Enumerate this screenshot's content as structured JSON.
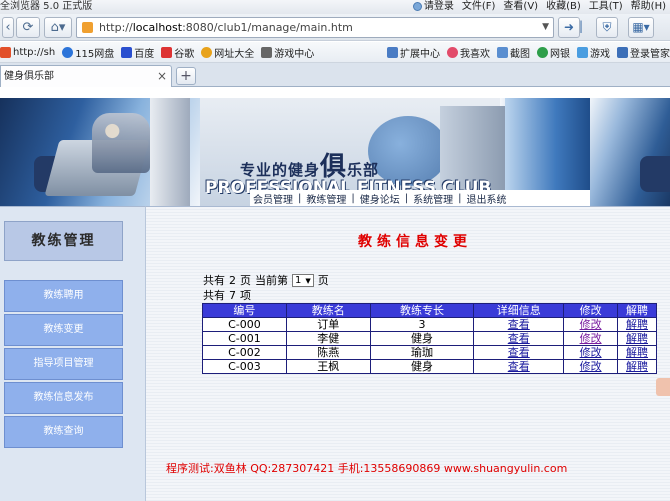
{
  "browser": {
    "app_title": "全浏览器 5.0 正式版",
    "login": "请登录",
    "menus": [
      "文件(F)",
      "查看(V)",
      "收藏(B)",
      "工具(T)",
      "帮助(H)"
    ],
    "url_prefix": "http://",
    "url_host": "localhost",
    "url_rest": ":8080/club1/manage/main.htm",
    "favorites": [
      "http://sh",
      "115网盘",
      "百度",
      "谷歌",
      "网址大全",
      "游戏中心"
    ],
    "fav_right": [
      "扩展中心",
      "我喜欢",
      "截图",
      "网银",
      "游戏",
      "登录管家"
    ],
    "tab_title": "健身俱乐部",
    "tab_close": "×",
    "new_tab": "+"
  },
  "banner": {
    "slogan_pre": "专业的健身",
    "slogan_big": "俱",
    "slogan_post": "乐部",
    "english": "PROFESSIONAL FITNESS CLUB",
    "menu": [
      "会员管理",
      "教练管理",
      "健身论坛",
      "系统管理",
      "退出系统"
    ]
  },
  "sidebar": {
    "title": "教练管理",
    "items": [
      "教练聘用",
      "教练变更",
      "指导项目管理",
      "教练信息发布",
      "教练查询"
    ]
  },
  "main": {
    "heading": "教练信息变更",
    "pager": {
      "total_pages_prefix": "共有",
      "total_pages": "2",
      "pages_unit": "页",
      "current_label": "当前第",
      "current": "1",
      "current_unit": "页",
      "total_items_prefix": "共有",
      "total_items": "7",
      "items_unit": "项"
    },
    "table": {
      "headers": [
        "编号",
        "教练名",
        "教练专长",
        "详细信息",
        "修改",
        "解聘"
      ],
      "rows": [
        {
          "id": "C-000",
          "name": "订单",
          "specialty": "3",
          "detail": "查看",
          "edit": "修改",
          "fire": "解聘"
        },
        {
          "id": "C-001",
          "name": "李健",
          "specialty": "健身",
          "detail": "查看",
          "edit": "修改",
          "fire": "解聘"
        },
        {
          "id": "C-002",
          "name": "陈燕",
          "specialty": "瑜珈",
          "detail": "查看",
          "edit": "修改",
          "fire": "解聘"
        },
        {
          "id": "C-003",
          "name": "王枫",
          "specialty": "健身",
          "detail": "查看",
          "edit": "修改",
          "fire": "解聘"
        }
      ]
    },
    "footer": "程序测试:双鱼林 QQ:287307421 手机:13558690869 www.shuangyulin.com"
  },
  "colors": {
    "table_header_bg": "#3a3bd8",
    "heading_red": "#e00000",
    "sidebar_item_bg": "#8fb0ec",
    "link_purple": "#7a1fa0"
  }
}
